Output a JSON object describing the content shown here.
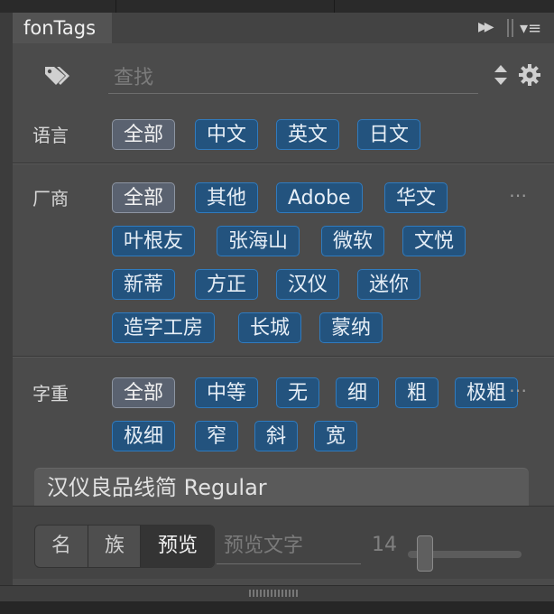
{
  "window": {
    "tab_title": "fonTags",
    "controls": [
      "double-arrow-icon",
      "panel-menu-icon"
    ]
  },
  "search": {
    "placeholder": "查找",
    "value": "",
    "icons": [
      "tag-icon",
      "sort-updown-icon",
      "gear-icon"
    ]
  },
  "filters": {
    "language": {
      "label": "语言",
      "tags": [
        "全部",
        "中文",
        "英文",
        "日文"
      ],
      "selected": "全部"
    },
    "vendor": {
      "label": "厂商",
      "tags": [
        "全部",
        "其他",
        "Adobe",
        "华文",
        "叶根友",
        "张海山",
        "微软",
        "文悦",
        "新蒂",
        "方正",
        "汉仪",
        "迷你",
        "造字工房",
        "长城",
        "蒙纳"
      ],
      "selected": "全部",
      "more": "⋯"
    },
    "weight": {
      "label": "字重",
      "tags": [
        "全部",
        "中等",
        "无",
        "细",
        "粗",
        "极粗",
        "极细",
        "窄",
        "斜",
        "宽"
      ],
      "selected": "全部",
      "more": "⋯"
    }
  },
  "preview": {
    "font_name": "汉仪良品线简 Regular"
  },
  "bottom": {
    "modes": [
      "名",
      "族",
      "预览"
    ],
    "active_mode": "预览",
    "preview_placeholder": "预览文字",
    "size": "14",
    "size_slider_fraction": 0.15
  },
  "colors": {
    "panel_bg": "#4b4b4b",
    "chip_bg": "#23537e",
    "chip_border": "#2f7bbf",
    "chip_all_bg": "#5a6270"
  }
}
